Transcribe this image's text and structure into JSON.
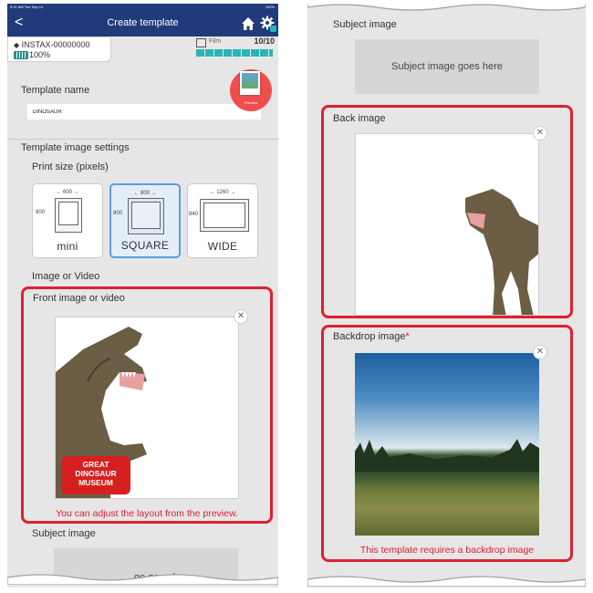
{
  "status_bar": {
    "time": "9:41 AM  Tue Sep 14",
    "battery": "100%"
  },
  "nav": {
    "back_glyph": "<",
    "title": "Create template",
    "home_icon": "home-icon",
    "settings_icon": "gear-icon"
  },
  "device": {
    "name": "INSTAX-00000000",
    "battery": "100%"
  },
  "film": {
    "label": "Film",
    "count": "10/10"
  },
  "template_name": {
    "label": "Template name",
    "value": "DINOSAUR"
  },
  "preview": {
    "label": "Preview"
  },
  "settings": {
    "heading": "Template image settings",
    "print_size_label": "Print size (pixels)"
  },
  "sizes": [
    {
      "label": "mini",
      "width": "600",
      "height": "800",
      "selected": false
    },
    {
      "label": "SQUARE",
      "width": "800",
      "height": "800",
      "selected": true
    },
    {
      "label": "WIDE",
      "width": "1260",
      "height": "840",
      "selected": false
    }
  ],
  "image_or_video_label": "Image or Video",
  "front": {
    "label": "Front image or video",
    "note": "You can adjust the layout from the preview.",
    "logo_text": [
      "GREAT",
      "DINOSAUR",
      "MUSEUM"
    ]
  },
  "subject": {
    "label": "Subject image",
    "placeholder": "Subject image goes here",
    "placeholder_cut": "ge goes here"
  },
  "back": {
    "label": "Back image"
  },
  "backdrop": {
    "label": "Backdrop image",
    "required_mark": "*",
    "note": "This template requires a backdrop image"
  },
  "colors": {
    "nav": "#1f3b7a",
    "accent_red": "#e0202e",
    "selected_blue": "#5a9ee0",
    "film_teal": "#29b5b5"
  }
}
